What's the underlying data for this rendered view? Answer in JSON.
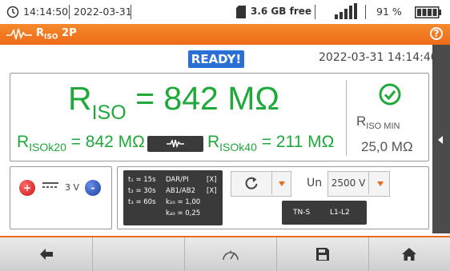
{
  "status": {
    "time": "14:14:50",
    "date": "2022-03-31",
    "storage": "3.6 GB free",
    "battery": "91 %"
  },
  "title": {
    "main": "R",
    "sub": "ISO",
    "suffix": " 2P"
  },
  "ready": "READY!",
  "datetime": "2022-03-31 14:14:40",
  "result": {
    "riso_symbol": "R",
    "riso_sub": "ISO",
    "riso_value": " = 842 MΩ",
    "k20_symbol": "R",
    "k20_sub": "ISOk20",
    "k20_value": " = 842 MΩ",
    "k40_symbol": "R",
    "k40_sub": "ISOk40",
    "k40_value": " = 211 MΩ",
    "min_symbol": "R",
    "min_sub": "ISO MIN",
    "min_value": "25,0 MΩ"
  },
  "probe": {
    "plus": "+",
    "minus": "-",
    "voltage": "3 V"
  },
  "times": {
    "t1": "t₁ = 15s",
    "t2": "t₂ = 30s",
    "t3": "t₃ = 60s",
    "dar": "DAR/PI",
    "dar_flag": "[X]",
    "ab": "AB1/AB2",
    "ab_flag": "[X]",
    "k20": "k₂₀ = 1,00",
    "k40": "k₄₀ = 0,25"
  },
  "un": {
    "label": "Un",
    "value": "2500 V"
  },
  "network": {
    "type": "TN-S",
    "phase": "L1-L2"
  },
  "toolbar": [
    "back-icon",
    "",
    "gauge-icon",
    "save-icon",
    "home-icon"
  ],
  "colors": {
    "accent": "#ef6a18",
    "result_green": "#1fa93a",
    "ready_blue": "#2a6fd6"
  }
}
